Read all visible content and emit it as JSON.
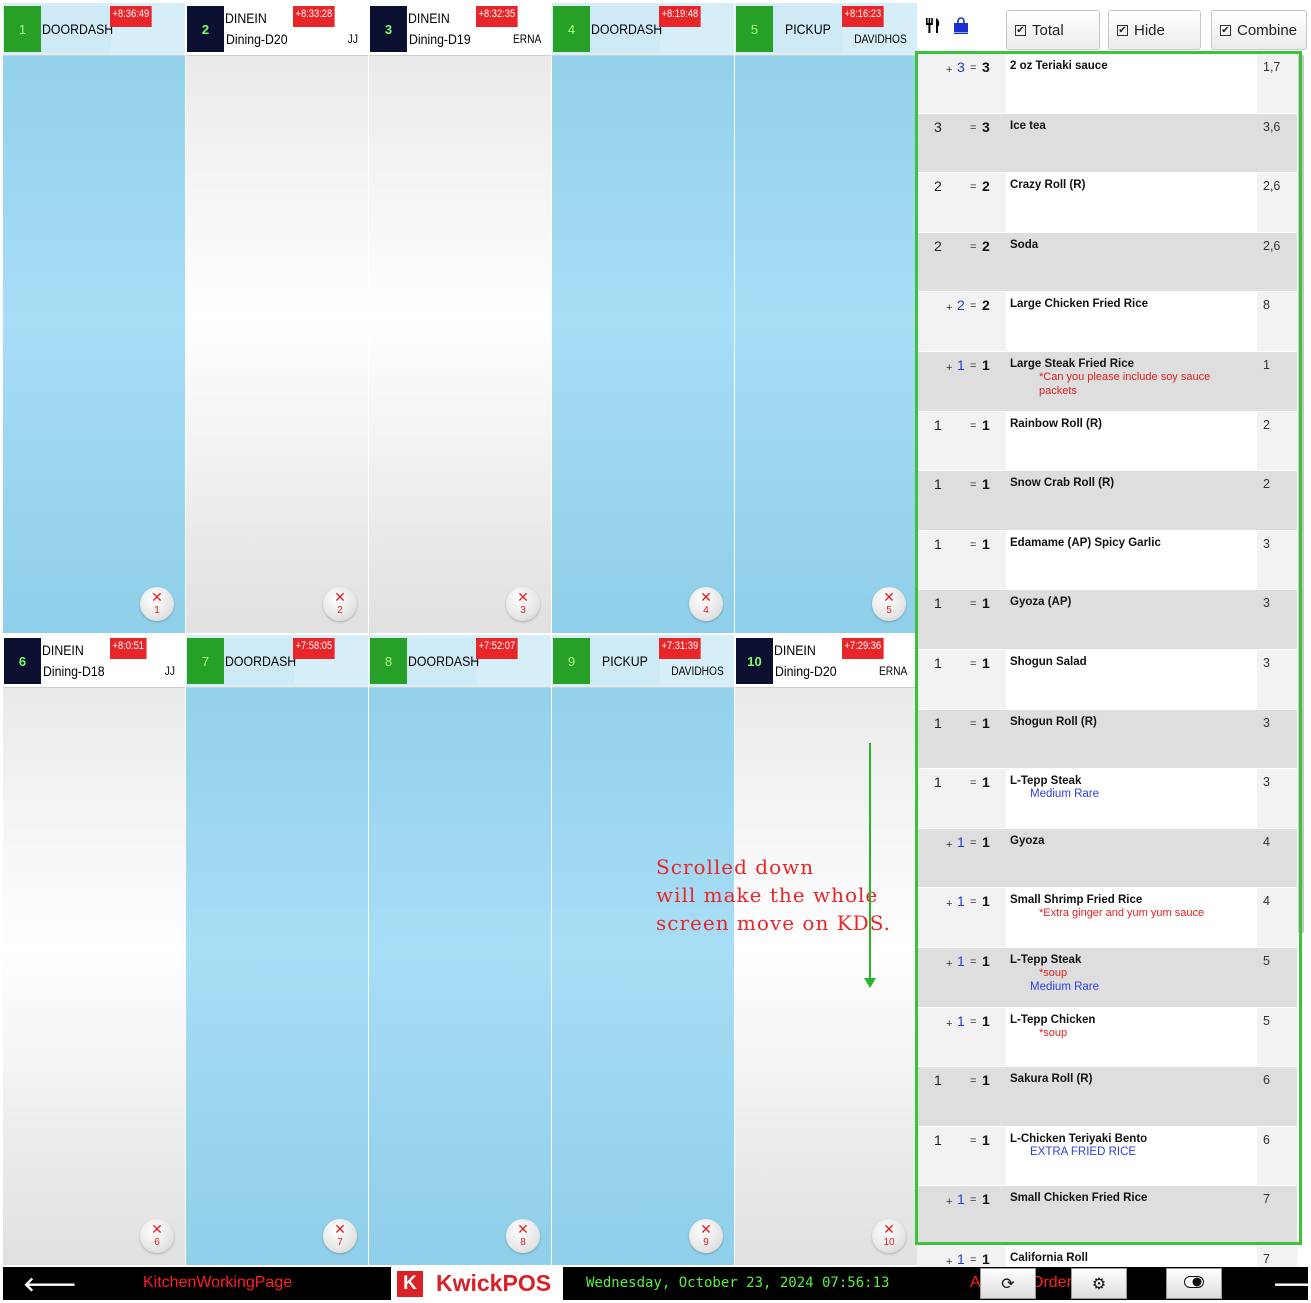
{
  "tiles": [
    {
      "number": "1",
      "type": "DOORDASH",
      "location": "",
      "timer": "+8:36:49",
      "server": "",
      "close_label": "1"
    },
    {
      "number": "2",
      "type": "DINEIN",
      "location": "Dining-D20",
      "timer": "+8:33:28",
      "server": "JJ",
      "close_label": "2"
    },
    {
      "number": "3",
      "type": "DINEIN",
      "location": "Dining-D19",
      "timer": "+8:32:35",
      "server": "ERNA",
      "close_label": "3"
    },
    {
      "number": "4",
      "type": "DOORDASH",
      "location": "",
      "timer": "+8:19:48",
      "server": "",
      "close_label": "4"
    },
    {
      "number": "5",
      "type": "PICKUP",
      "location": "",
      "timer": "+8:16:23",
      "server": "DAVIDHOS",
      "close_label": "5"
    },
    {
      "number": "6",
      "type": "DINEIN",
      "location": "Dining-D18",
      "timer": "+8:0:51",
      "server": "JJ",
      "close_label": "6"
    },
    {
      "number": "7",
      "type": "DOORDASH",
      "location": "",
      "timer": "+7:58:05",
      "server": "",
      "close_label": "7"
    },
    {
      "number": "8",
      "type": "DOORDASH",
      "location": "",
      "timer": "+7:52:07",
      "server": "",
      "close_label": "8"
    },
    {
      "number": "9",
      "type": "PICKUP",
      "location": "",
      "timer": "+7:31:39",
      "server": "DAVIDHOS",
      "close_label": "9"
    },
    {
      "number": "10",
      "type": "DINEIN",
      "location": "Dining-D20",
      "timer": "+7:29:36",
      "server": "ERNA",
      "close_label": "10"
    }
  ],
  "toolbar": {
    "dinein_icon": "fork-knife-icon",
    "togo_icon": "shopping-bag-icon",
    "total_label": "Total",
    "hide_label": "Hide",
    "combine_label": "Combine",
    "check_glyph": "✔"
  },
  "items": [
    {
      "new": "3",
      "total": "3",
      "name": "2 oz Teriaki sauce",
      "notes": [],
      "mods": [],
      "minutes": "1,7"
    },
    {
      "qty": "3",
      "total": "3",
      "name": "Ice tea",
      "notes": [],
      "mods": [],
      "minutes": "3,6"
    },
    {
      "qty": "2",
      "total": "2",
      "name": "Crazy Roll (R)",
      "notes": [],
      "mods": [],
      "minutes": "2,6"
    },
    {
      "qty": "2",
      "total": "2",
      "name": "Soda",
      "notes": [],
      "mods": [],
      "minutes": "2,6"
    },
    {
      "new": "2",
      "total": "2",
      "name": "Large Chicken Fried Rice",
      "notes": [],
      "mods": [],
      "minutes": "8"
    },
    {
      "new": "1",
      "total": "1",
      "name": "Large Steak Fried Rice",
      "notes": [
        "*Can you please include soy sauce",
        "packets"
      ],
      "mods": [],
      "minutes": "1"
    },
    {
      "qty": "1",
      "total": "1",
      "name": "Rainbow Roll (R)",
      "notes": [],
      "mods": [],
      "minutes": "2"
    },
    {
      "qty": "1",
      "total": "1",
      "name": "Snow Crab Roll (R)",
      "notes": [],
      "mods": [],
      "minutes": "2"
    },
    {
      "qty": "1",
      "total": "1",
      "name": "Edamame (AP) Spicy Garlic",
      "notes": [],
      "mods": [],
      "minutes": "3"
    },
    {
      "qty": "1",
      "total": "1",
      "name": "Gyoza (AP)",
      "notes": [],
      "mods": [],
      "minutes": "3"
    },
    {
      "qty": "1",
      "total": "1",
      "name": "Shogun Salad",
      "notes": [],
      "mods": [],
      "minutes": "3"
    },
    {
      "qty": "1",
      "total": "1",
      "name": "Shogun Roll (R)",
      "notes": [],
      "mods": [],
      "minutes": "3"
    },
    {
      "qty": "1",
      "total": "1",
      "name": "L-Tepp Steak",
      "notes": [],
      "mods": [
        "Medium Rare"
      ],
      "minutes": "3"
    },
    {
      "new": "1",
      "total": "1",
      "name": "Gyoza",
      "notes": [],
      "mods": [],
      "minutes": "4"
    },
    {
      "new": "1",
      "total": "1",
      "name": "Small Shrimp Fried Rice",
      "notes": [
        "*Extra ginger and yum yum sauce"
      ],
      "mods": [],
      "minutes": "4"
    },
    {
      "new": "1",
      "total": "1",
      "name": "L-Tepp Steak",
      "notes": [
        "*soup"
      ],
      "mods": [
        "Medium Rare"
      ],
      "minutes": "5"
    },
    {
      "new": "1",
      "total": "1",
      "name": "L-Tepp Chicken",
      "notes": [
        "*soup"
      ],
      "mods": [],
      "minutes": "5"
    },
    {
      "qty": "1",
      "total": "1",
      "name": "Sakura Roll (R)",
      "notes": [],
      "mods": [],
      "minutes": "6"
    },
    {
      "qty": "1",
      "total": "1",
      "name": "L-Chicken Teriyaki Bento",
      "notes": [],
      "mods": [
        "EXTRA FRIED RICE"
      ],
      "minutes": "6"
    },
    {
      "new": "1",
      "total": "1",
      "name": "Small Chicken Fried Rice",
      "notes": [],
      "mods": [],
      "minutes": "7"
    },
    {
      "new": "1",
      "total": "1",
      "name": "California Roll",
      "notes": [],
      "mods": [],
      "minutes": "7"
    }
  ],
  "annotation": {
    "lines": [
      "Scrolled down",
      "will make the whole",
      "screen move on KDS."
    ],
    "color": "#e8262a",
    "arrow_color": "#2bb42b"
  },
  "bottom_bar": {
    "back_icon": "arrow-left-icon",
    "page_name": "KitchenWorkingPage",
    "logo_letter": "K",
    "logo_text": "KwickPOS",
    "datetime": "Wednesday, October 23, 2024 07:56:13",
    "partial_a": "A",
    "partial_orders": "Order",
    "refresh_icon": "refresh-icon",
    "settings_icon": "gears-icon",
    "toggle_icon": "toggle-icon",
    "forward_icon": "arrow-right-icon"
  },
  "colors": {
    "timer_red": "#e8262a",
    "tile_blue": "#a8ddf6",
    "delivery_green": "#27a027",
    "dinein_navy": "#0b1030",
    "selection_green": "#3bc43b"
  }
}
